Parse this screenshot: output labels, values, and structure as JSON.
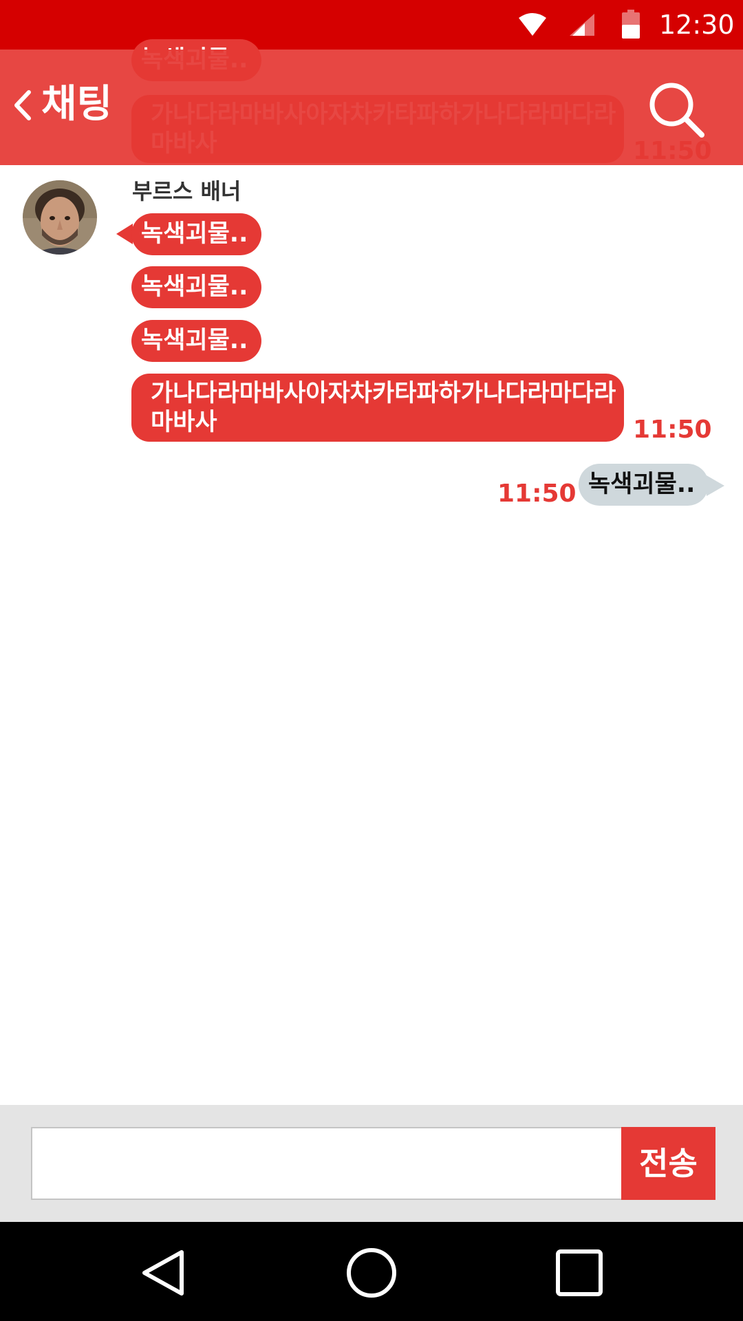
{
  "status_bar": {
    "time": "12:30",
    "icons": [
      "wifi-icon",
      "cell-signal-icon",
      "battery-icon"
    ]
  },
  "app_bar": {
    "back_icon": "chevron-left-icon",
    "title": "채팅",
    "search_icon": "search-icon"
  },
  "chat": {
    "sender_name": "부르스 배너",
    "incoming": [
      {
        "text": "녹색괴물.."
      },
      {
        "text": "녹색괴물.."
      },
      {
        "text": "녹색괴물.."
      },
      {
        "text": "가나다라마바사아자차카타파하가나다라마다라마바사"
      }
    ],
    "incoming_time": "11:50",
    "outgoing": [
      {
        "text": "녹색괴물..",
        "time": "11:50"
      }
    ]
  },
  "input_bar": {
    "value": "",
    "send_label": "전송"
  },
  "nav_bar": {
    "icons": [
      "nav-back-icon",
      "nav-home-icon",
      "nav-recents-icon"
    ]
  },
  "colors": {
    "status_bar": "#d50000",
    "accent": "#e53935",
    "outgoing_bubble": "#cfd8dc",
    "input_bar_bg": "#e4e4e4",
    "nav_bar": "#000000"
  }
}
